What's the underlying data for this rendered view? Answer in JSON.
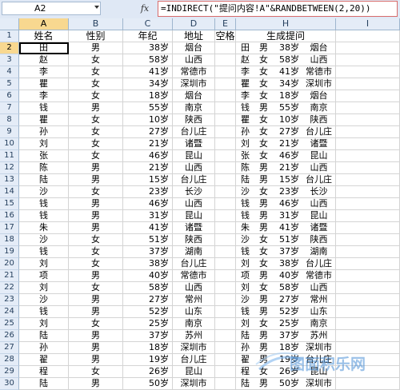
{
  "formula_bar": {
    "name_box": "A2",
    "fx_label": "fx",
    "formula": "=INDIRECT(\"提问内容!A\"&RANDBETWEEN(2,20))"
  },
  "columns": [
    "A",
    "B",
    "C",
    "D",
    "E",
    "H",
    "I"
  ],
  "row_numbers": [
    "1",
    "2",
    "3",
    "4",
    "5",
    "6",
    "7",
    "8",
    "9",
    "10",
    "11",
    "12",
    "13",
    "14",
    "15",
    "16",
    "17",
    "18",
    "19",
    "20",
    "21",
    "22",
    "23",
    "24",
    "25",
    "26",
    "27",
    "28",
    "29",
    "30"
  ],
  "header": {
    "name": "姓名",
    "gender": "性别",
    "age": "年纪",
    "place": "地址",
    "space": "空格",
    "gen": "生成提问"
  },
  "rows": [
    [
      "田",
      "男",
      "38岁",
      "烟台",
      "田",
      "男",
      "38岁",
      "烟台"
    ],
    [
      "赵",
      "女",
      "58岁",
      "山西",
      "赵",
      "女",
      "58岁",
      "山西"
    ],
    [
      "李",
      "女",
      "41岁",
      "常德市",
      "李",
      "女",
      "41岁",
      "常德市"
    ],
    [
      "瞿",
      "女",
      "34岁",
      "深圳市",
      "瞿",
      "女",
      "34岁",
      "深圳市"
    ],
    [
      "李",
      "女",
      "18岁",
      "烟台",
      "李",
      "女",
      "18岁",
      "烟台"
    ],
    [
      "钱",
      "男",
      "55岁",
      "南京",
      "钱",
      "男",
      "55岁",
      "南京"
    ],
    [
      "瞿",
      "女",
      "10岁",
      "陕西",
      "瞿",
      "女",
      "10岁",
      "陕西"
    ],
    [
      "孙",
      "女",
      "27岁",
      "台儿庄",
      "孙",
      "女",
      "27岁",
      "台儿庄"
    ],
    [
      "刘",
      "女",
      "21岁",
      "诸暨",
      "刘",
      "女",
      "21岁",
      "诸暨"
    ],
    [
      "张",
      "女",
      "46岁",
      "昆山",
      "张",
      "女",
      "46岁",
      "昆山"
    ],
    [
      "陈",
      "男",
      "21岁",
      "山西",
      "陈",
      "男",
      "21岁",
      "山西"
    ],
    [
      "陆",
      "男",
      "15岁",
      "台儿庄",
      "陆",
      "男",
      "15岁",
      "台儿庄"
    ],
    [
      "沙",
      "女",
      "23岁",
      "长沙",
      "沙",
      "女",
      "23岁",
      "长沙"
    ],
    [
      "钱",
      "男",
      "46岁",
      "山西",
      "钱",
      "男",
      "46岁",
      "山西"
    ],
    [
      "钱",
      "男",
      "31岁",
      "昆山",
      "钱",
      "男",
      "31岁",
      "昆山"
    ],
    [
      "朱",
      "男",
      "41岁",
      "诸暨",
      "朱",
      "男",
      "41岁",
      "诸暨"
    ],
    [
      "沙",
      "女",
      "51岁",
      "陕西",
      "沙",
      "女",
      "51岁",
      "陕西"
    ],
    [
      "钱",
      "女",
      "37岁",
      "湖南",
      "钱",
      "女",
      "37岁",
      "湖南"
    ],
    [
      "刘",
      "女",
      "38岁",
      "台儿庄",
      "刘",
      "女",
      "38岁",
      "台儿庄"
    ],
    [
      "项",
      "男",
      "40岁",
      "常德市",
      "项",
      "男",
      "40岁",
      "常德市"
    ],
    [
      "刘",
      "女",
      "58岁",
      "山西",
      "刘",
      "女",
      "58岁",
      "山西"
    ],
    [
      "沙",
      "男",
      "27岁",
      "常州",
      "沙",
      "男",
      "27岁",
      "常州"
    ],
    [
      "钱",
      "男",
      "52岁",
      "山东",
      "钱",
      "男",
      "52岁",
      "山东"
    ],
    [
      "刘",
      "女",
      "25岁",
      "南京",
      "刘",
      "女",
      "25岁",
      "南京"
    ],
    [
      "陆",
      "男",
      "37岁",
      "苏州",
      "陆",
      "男",
      "37岁",
      "苏州"
    ],
    [
      "孙",
      "男",
      "18岁",
      "深圳市",
      "孙",
      "男",
      "18岁",
      "深圳市"
    ],
    [
      "翟",
      "男",
      "19岁",
      "台儿庄",
      "翟",
      "男",
      "19岁",
      "台儿庄"
    ],
    [
      "程",
      "女",
      "26岁",
      "昆山",
      "程",
      "女",
      "26岁",
      "昆山"
    ],
    [
      "陆",
      "男",
      "50岁",
      "深圳市",
      "陆",
      "男",
      "50岁",
      "深圳市"
    ]
  ],
  "watermark": {
    "text": "图面积乐网",
    "color": "#4a8fd6"
  }
}
